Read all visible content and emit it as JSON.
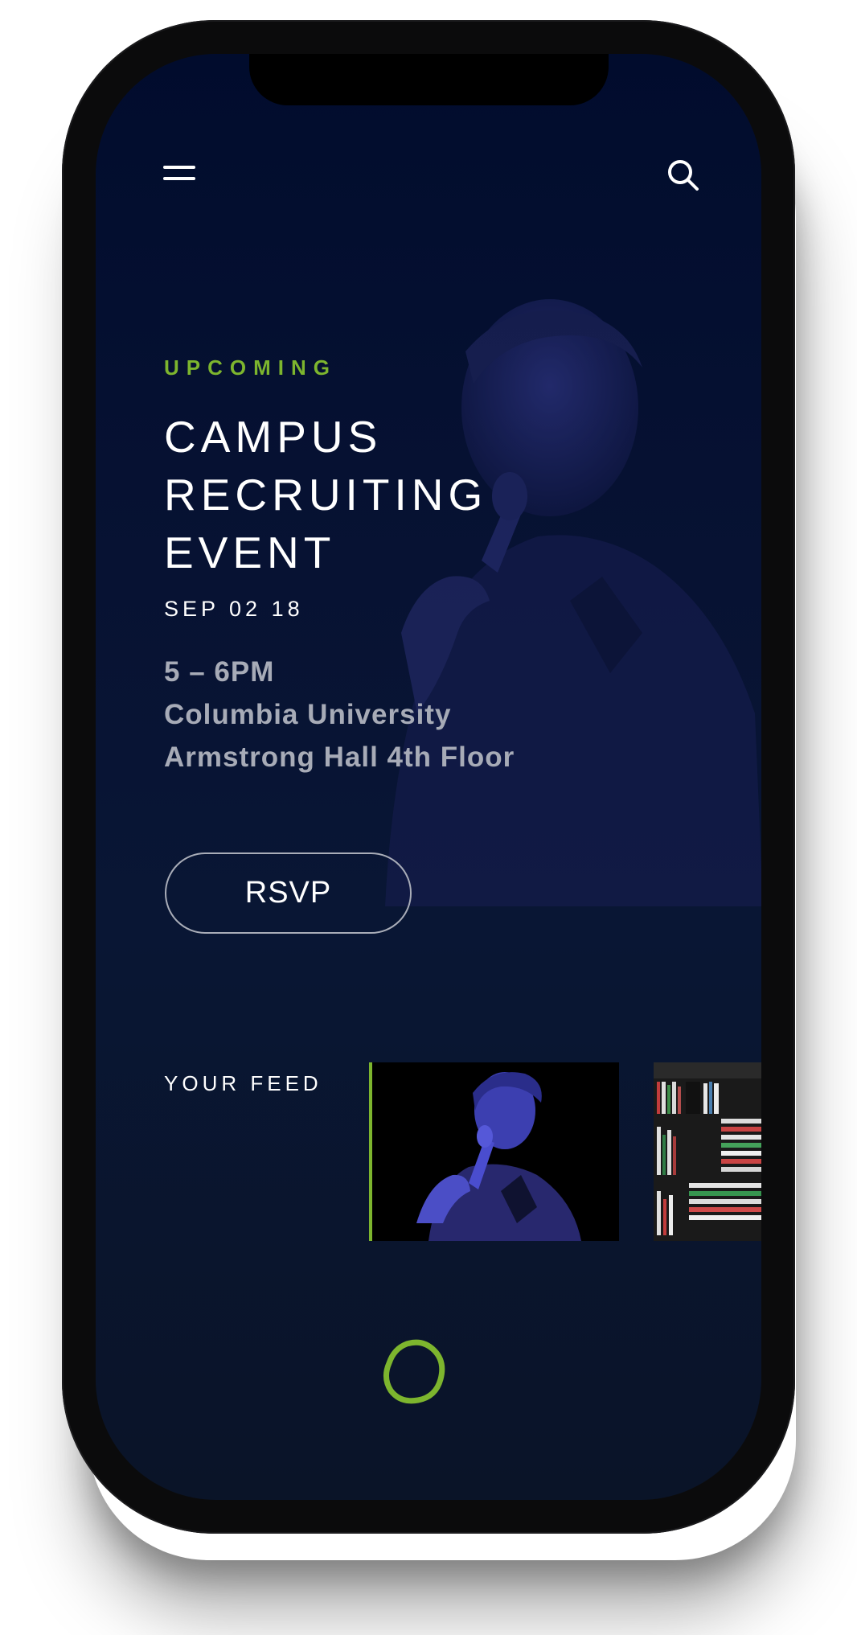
{
  "header": {
    "menu_icon": "hamburger-menu-icon",
    "search_icon": "search-icon"
  },
  "event": {
    "status": "UPCOMING",
    "title_lines": [
      "CAMPUS",
      "RECRUITING",
      "EVENT"
    ],
    "date": "SEP 02 18",
    "time": "5 – 6PM",
    "location_line1": "Columbia University",
    "location_line2": "Armstrong Hall 4th Floor",
    "rsvp_label": "RSVP"
  },
  "feed": {
    "label": "YOUR FEED",
    "items": [
      {
        "icon": "speaker-photo"
      },
      {
        "icon": "bookshelf-photo"
      }
    ]
  },
  "bottom": {
    "home_icon": "blob-ring-icon"
  },
  "colors": {
    "accent": "#7db52e",
    "background": "#071233",
    "text_primary": "#ffffff",
    "text_secondary": "#a7abb7"
  }
}
